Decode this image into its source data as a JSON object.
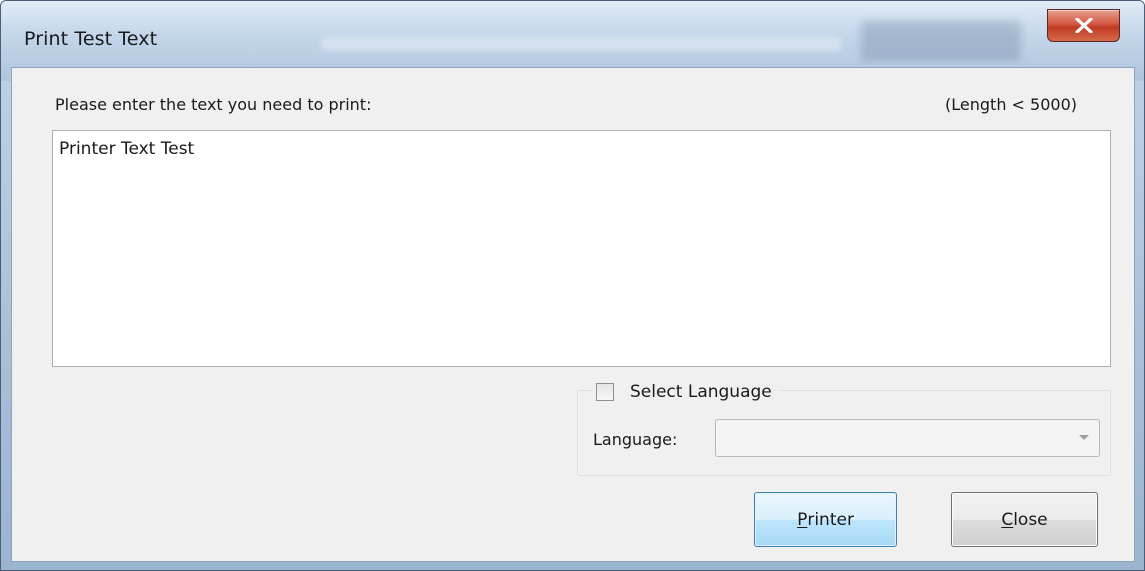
{
  "window": {
    "title": "Print Test Text",
    "close_icon": "close-x-icon"
  },
  "form": {
    "prompt": "Please enter the text you need to print:",
    "length_hint": "(Length < 5000)",
    "text_value": "Printer Text Test"
  },
  "language_group": {
    "checkbox_label": "Select Language",
    "checkbox_checked": false,
    "language_label": "Language:",
    "language_value": ""
  },
  "buttons": {
    "printer_mnemonic": "P",
    "printer_rest": "rinter",
    "close_mnemonic": "C",
    "close_rest": "lose"
  }
}
